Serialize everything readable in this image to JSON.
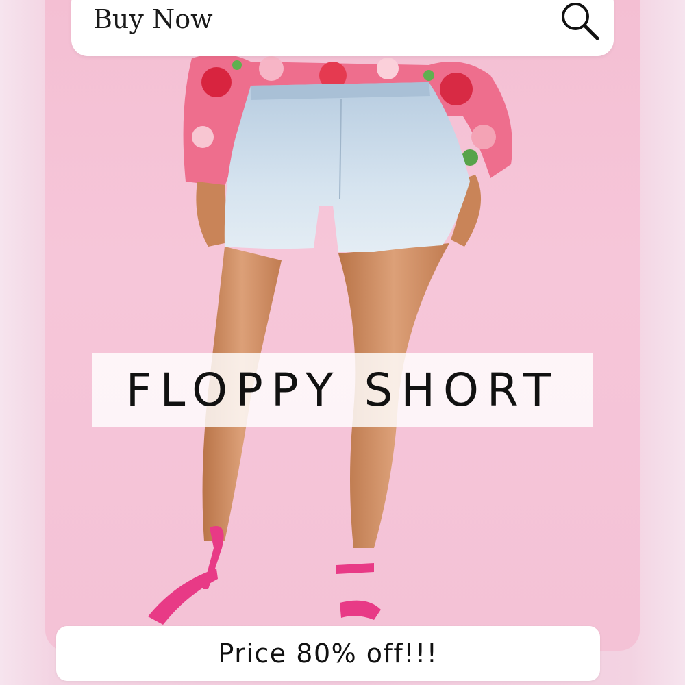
{
  "search": {
    "label": "Buy Now",
    "icon": "search-icon"
  },
  "product": {
    "title": "FLOPPY SHORT",
    "price_text": "Price 80% off!!!"
  },
  "colors": {
    "panel_pink": "#f4c2d6",
    "backdrop": "#f3d3e2",
    "denim": "#c9dbe8",
    "skin": "#d79a6e",
    "heel_pink": "#e83a86"
  }
}
